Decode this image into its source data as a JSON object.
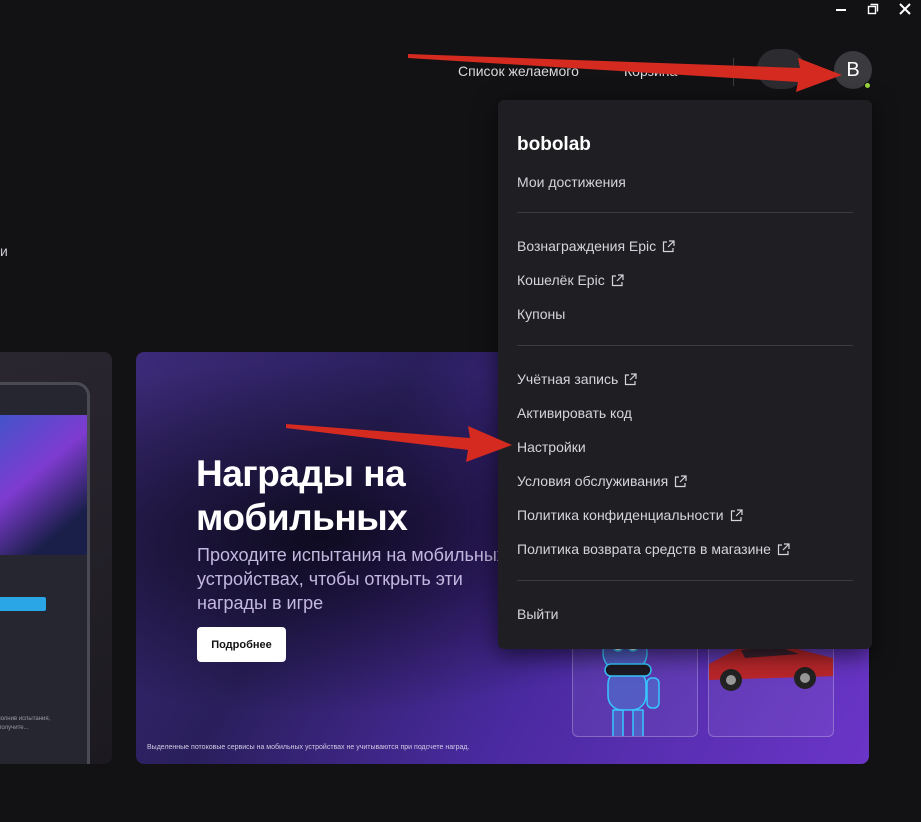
{
  "window": {
    "icons": [
      "minimize-icon",
      "restore-icon",
      "close-icon"
    ]
  },
  "header": {
    "wishlist": "Список желаемого",
    "cart": "Корзина",
    "avatar_letter": "B"
  },
  "side_text": "и",
  "promo": {
    "title_line1": "Награды на",
    "title_line2": "мобильных",
    "subtitle": "Проходите испытания на мобильных устройствах, чтобы открыть эти награды в игре",
    "button": "Подробнее",
    "note": "Выделенные потоковые сервисы на мобильных устройствах не учитываются при подсчете наград."
  },
  "left_card": {
    "text": "Выполнив испытания, вы получите..."
  },
  "menu": {
    "username": "bobolab",
    "achievements": "Мои достижения",
    "items_group2": [
      {
        "label": "Вознаграждения Epic",
        "external": true
      },
      {
        "label": "Кошелёк Epic",
        "external": true
      },
      {
        "label": "Купоны",
        "external": false
      }
    ],
    "items_group3": [
      {
        "label": "Учётная запись",
        "external": true
      },
      {
        "label": "Активировать код",
        "external": false
      },
      {
        "label": "Настройки",
        "external": false
      },
      {
        "label": "Условия обслуживания",
        "external": true
      },
      {
        "label": "Политика конфиденциальности",
        "external": true
      },
      {
        "label": "Политика возврата средств в магазине",
        "external": true
      }
    ],
    "logout": "Выйти"
  },
  "colors": {
    "accent_arrow": "#d42a20",
    "online_dot": "#9ad33c",
    "menu_bg": "#1f1f23"
  }
}
